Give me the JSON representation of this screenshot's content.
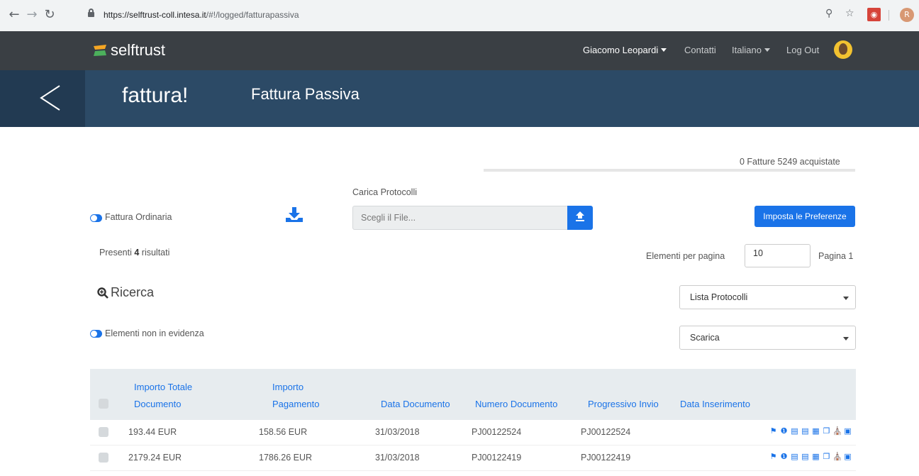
{
  "browser": {
    "url_host": "https://selftrust-coll.intesa.it",
    "url_path": "/#!/logged/fatturapassiva",
    "profile_initial": "R"
  },
  "topnav": {
    "logo": "selftrust",
    "user": "Giacomo Leopardi",
    "contacts": "Contatti",
    "language": "Italiano",
    "logout": "Log Out"
  },
  "header": {
    "brand": "fattura!",
    "title": "Fattura Passiva"
  },
  "status": {
    "counter_text": "0 Fatture 5249 acquistate",
    "progress_fraction": 0.0
  },
  "controls": {
    "toggle_ordinaria_label": "Fattura Ordinaria",
    "carica_label": "Carica Protocolli",
    "file_placeholder": "Scegli il File...",
    "pref_button": "Imposta le Preferenze",
    "results_prefix": "Presenti",
    "results_count": "4",
    "results_suffix": "risultati",
    "per_page_label": "Elementi per pagina",
    "per_page_value": "10",
    "page_label": "Pagina 1",
    "search_label": "Ricerca",
    "select_protocolli": "Lista Protocolli",
    "toggle_evidenza_label": "Elementi non in evidenza",
    "select_scarica": "Scarica"
  },
  "table": {
    "headers": {
      "importo_totale_1": "Importo Totale",
      "importo_totale_2": "Documento",
      "importo_pagamento_1": "Importo",
      "importo_pagamento_2": "Pagamento",
      "data_documento": "Data Documento",
      "numero_documento": "Numero Documento",
      "progressivo_invio": "Progressivo Invio",
      "data_inserimento": "Data Inserimento"
    },
    "rows": [
      {
        "importo_totale": "193.44 EUR",
        "importo_pagamento": "158.56 EUR",
        "data_documento": "31/03/2018",
        "numero_documento": "PJ00122524",
        "progressivo_invio": "PJ00122524",
        "data_inserimento": ""
      },
      {
        "importo_totale": "2179.24 EUR",
        "importo_pagamento": "1786.26 EUR",
        "data_documento": "31/03/2018",
        "numero_documento": "PJ00122419",
        "progressivo_invio": "PJ00122419",
        "data_inserimento": ""
      }
    ]
  },
  "colors": {
    "accent": "#1a73e8",
    "topnav": "#3a3f44",
    "header": "#2c4a66"
  }
}
